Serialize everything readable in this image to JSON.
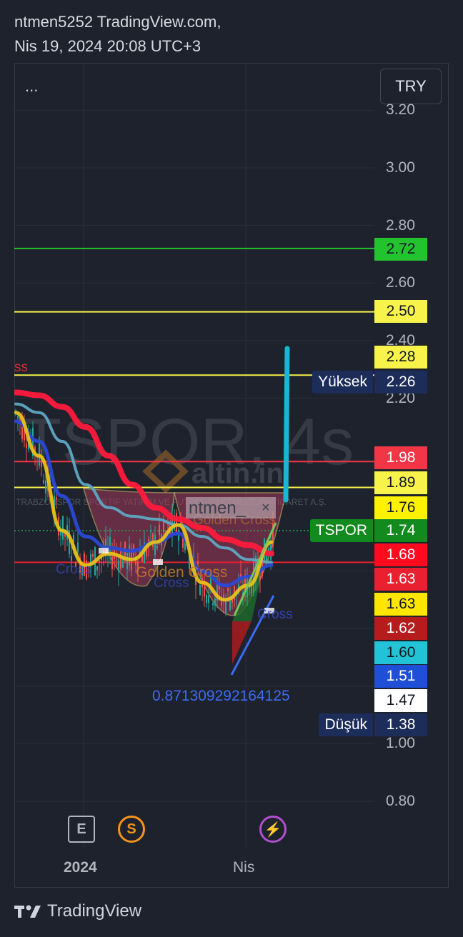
{
  "header": {
    "line1": "ntmen5252 TradingView.com,",
    "line2": "Nis 19, 2024 20:08 UTC+3"
  },
  "toolbar": {
    "menu_label": "...",
    "currency_label": "TRY"
  },
  "watermark": {
    "symbol_text": "TSPOR, 4s",
    "site_text": "altin.in",
    "company_text": "TRABZONSPOR SPORTİF YATIRIM VE FUTBOL İŞLETMECİLİĞİ TİCARET A.Ş."
  },
  "annotations": {
    "user_tag": "ntmen_",
    "user_tag_close": "×",
    "golden_cross_1": "Golden Cross",
    "golden_cross_2": "Golden Cross",
    "cross_1": "Cross",
    "cross_2": "Cross",
    "cross_3": "Cross",
    "cross_left": "ss",
    "target_value": "0.871309292164125"
  },
  "axis": {
    "ticks": [
      "3.20",
      "3.00",
      "2.80",
      "2.60",
      "2.40",
      "2.20",
      "1.00",
      "0.80"
    ],
    "time_labels": [
      "2024",
      "Nis"
    ]
  },
  "price_tags": [
    {
      "value": "2.72",
      "bg": "#22c32e",
      "fg": "#131722"
    },
    {
      "value": "2.50",
      "bg": "#f7f34a",
      "fg": "#131722"
    },
    {
      "value": "2.28",
      "bg": "#f7f34a",
      "fg": "#131722"
    },
    {
      "value": "2.26",
      "bg": "#1c2d5a",
      "fg": "#ffffff",
      "name": "Yüksek"
    },
    {
      "value": "1.98",
      "bg": "#f23645",
      "fg": "#ffffff"
    },
    {
      "value": "1.89",
      "bg": "#f7f34a",
      "fg": "#131722"
    },
    {
      "value": "1.76",
      "bg": "#fff200",
      "fg": "#131722"
    },
    {
      "value": "1.74",
      "bg": "#138a1d",
      "fg": "#ffffff",
      "name": "TSPOR"
    },
    {
      "value": "1.68",
      "bg": "#ff0a1e",
      "fg": "#ffffff"
    },
    {
      "value": "1.63",
      "bg": "#e8202f",
      "fg": "#ffffff"
    },
    {
      "value": "1.63",
      "bg": "#ffe600",
      "fg": "#131722"
    },
    {
      "value": "1.62",
      "bg": "#b71c1c",
      "fg": "#ffffff"
    },
    {
      "value": "1.60",
      "bg": "#22c3d6",
      "fg": "#131722"
    },
    {
      "value": "1.51",
      "bg": "#1f4fd6",
      "fg": "#ffffff"
    },
    {
      "value": "1.47",
      "bg": "#ffffff",
      "fg": "#131722"
    },
    {
      "value": "1.38",
      "bg": "#1c2d5a",
      "fg": "#ffffff",
      "name": "Düşük"
    }
  ],
  "bottom_icons": [
    {
      "label": "E",
      "icon": "earnings-icon",
      "color": "#b2b5be"
    },
    {
      "label": "S",
      "icon": "split-icon",
      "color": "#f7931a"
    },
    {
      "label": "⚡",
      "icon": "lightning-icon",
      "color": "#b24fd0"
    }
  ],
  "footer": {
    "brand": "TradingView"
  },
  "chart_data": {
    "type": "line",
    "symbol": "TSPOR",
    "timeframe": "4s",
    "currency": "TRY",
    "y_range": [
      0.74,
      3.23
    ],
    "y_ticks": [
      0.8,
      1.0,
      2.2,
      2.4,
      2.6,
      2.8,
      3.0,
      3.2
    ],
    "x_labels": [
      "2024",
      "Nis"
    ],
    "last_price": 1.74,
    "high": 2.26,
    "low": 1.38,
    "horizontal_levels": [
      {
        "price": 2.72,
        "color": "#22c32e"
      },
      {
        "price": 2.5,
        "color": "#f7f34a"
      },
      {
        "price": 2.28,
        "color": "#f7f34a"
      },
      {
        "price": 1.98,
        "color": "#f23645"
      },
      {
        "price": 1.89,
        "color": "#f7f34a"
      },
      {
        "price": 1.63,
        "color": "#e8202f"
      }
    ],
    "moving_averages": [
      {
        "color": "#ff1a3c",
        "values": [
          2.22,
          2.21,
          2.17,
          2.1,
          2.0,
          1.9,
          1.82,
          1.78,
          1.75,
          1.71,
          1.69,
          1.66
        ]
      },
      {
        "color": "#5fa8c2",
        "values": [
          2.18,
          2.15,
          2.05,
          1.9,
          1.82,
          1.79,
          1.78,
          1.76,
          1.72,
          1.68,
          1.64,
          1.63
        ]
      },
      {
        "color": "#2a49d6",
        "values": [
          2.12,
          2.05,
          1.86,
          1.72,
          1.68,
          1.67,
          1.7,
          1.73,
          1.6,
          1.55,
          1.58,
          1.62
        ]
      },
      {
        "color": "#e6c21a",
        "values": [
          2.15,
          2.0,
          1.74,
          1.62,
          1.66,
          1.64,
          1.7,
          1.76,
          1.56,
          1.5,
          1.55,
          1.7
        ]
      }
    ],
    "breakout_target": 0.871309292164125
  }
}
